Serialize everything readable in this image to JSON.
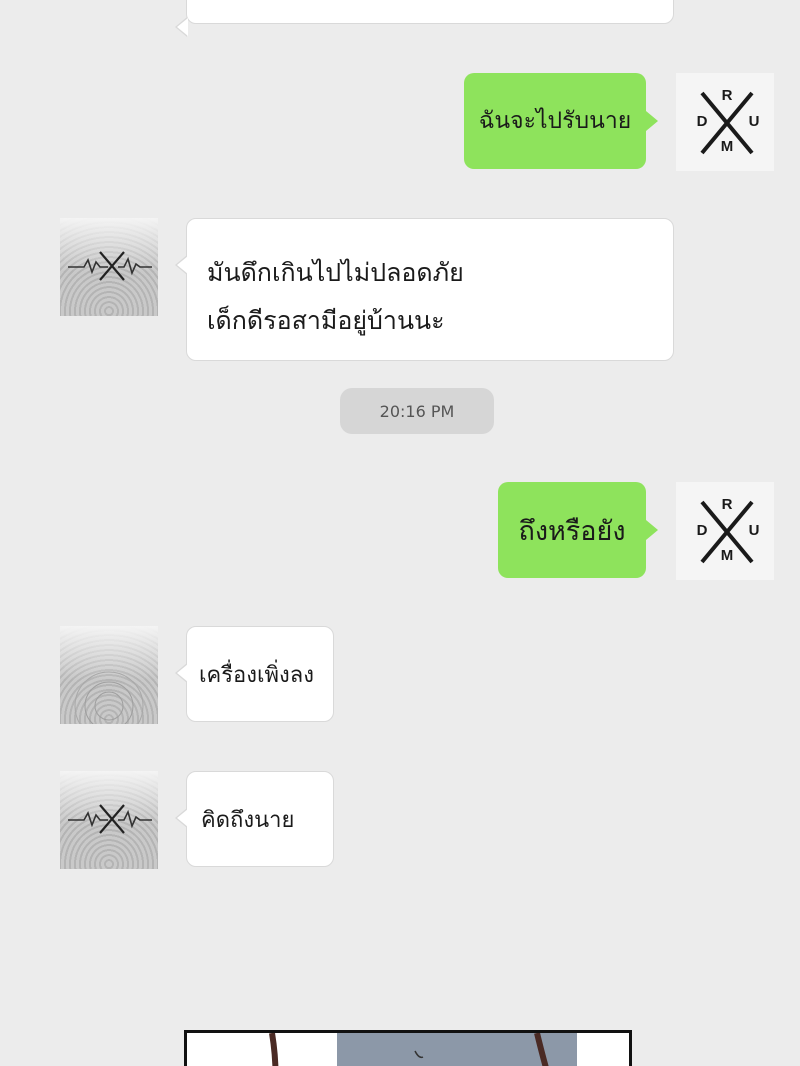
{
  "messages": [
    {
      "id": "m1",
      "direction": "outgoing",
      "sender": "drum",
      "text": "ฉันจะไปรับนาย"
    },
    {
      "id": "m2",
      "direction": "incoming",
      "sender": "pulse",
      "lines": [
        "มันดึกเกินไปไม่ปลอดภัย",
        "เด็กดีรอสามีอยู่บ้านนะ"
      ]
    },
    {
      "id": "m3",
      "direction": "outgoing",
      "sender": "drum",
      "text": "ถึงหรือยัง"
    },
    {
      "id": "m4",
      "direction": "incoming",
      "sender": "fingerprint",
      "text": "เครื่องเพิ่งลง"
    },
    {
      "id": "m5",
      "direction": "incoming",
      "sender": "pulse",
      "text": "คิดถึงนาย"
    }
  ],
  "timestamp": "20:16 PM",
  "avatars": {
    "drum_letters": [
      "R",
      "D",
      "U",
      "M"
    ],
    "pulse_icon": "heartbeat-x-icon",
    "fingerprint_icon": "fingerprint-icon"
  },
  "colors": {
    "outgoing_bubble": "#8ee35c",
    "incoming_bubble": "#ffffff",
    "timestamp_pill": "#d6d6d6",
    "background": "#ececec"
  }
}
